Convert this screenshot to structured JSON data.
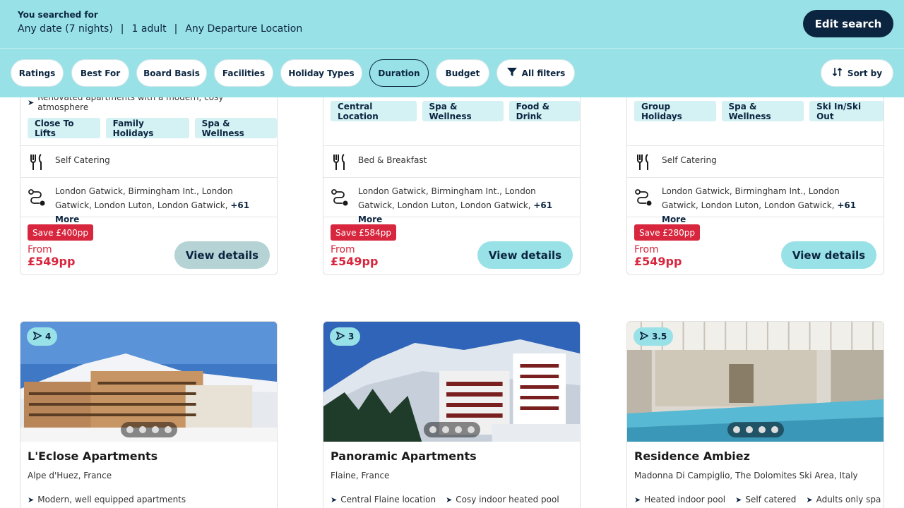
{
  "search": {
    "label": "You searched for",
    "date": "Any date (7 nights)",
    "guests": "1 adult",
    "departure": "Any Departure Location",
    "edit_label": "Edit search"
  },
  "filters": [
    "Ratings",
    "Best For",
    "Board Basis",
    "Facilities",
    "Holiday Types",
    "Duration",
    "Budget",
    "All filters"
  ],
  "sort_label": "Sort by",
  "top_cards": [
    {
      "highlight": "Renovated apartments with a modern, cosy atmosphere",
      "tags": [
        "Close To Lifts",
        "Family Holidays",
        "Spa & Wellness"
      ],
      "board": "Self Catering",
      "flights": "London Gatwick, Birmingham Int., London Gatwick, London Luton, London Gatwick,",
      "more": "+61 More",
      "save": "Save £400pp",
      "from": "From",
      "price": "£549pp",
      "button": "View details"
    },
    {
      "tags": [
        "Central Location",
        "Spa & Wellness",
        "Food & Drink"
      ],
      "board": "Bed & Breakfast",
      "flights": "London Gatwick, Birmingham Int., London Gatwick, London Luton, London Gatwick,",
      "more": "+61 More",
      "save": "Save £584pp",
      "from": "From",
      "price": "£549pp",
      "button": "View details"
    },
    {
      "tags": [
        "Group Holidays",
        "Spa & Wellness",
        "Ski In/Ski Out"
      ],
      "board": "Self Catering",
      "flights": "London Gatwick, Birmingham Int., London Gatwick, London Luton, London Gatwick,",
      "more": "+61 More",
      "save": "Save £280pp",
      "from": "From",
      "price": "£549pp",
      "button": "View details"
    }
  ],
  "bottom_cards": [
    {
      "rating": "4",
      "name": "L'Eclose Apartments",
      "location": "Alpe d'Huez, France",
      "features": [
        "Modern, well equipped apartments"
      ]
    },
    {
      "rating": "3",
      "name": "Panoramic Apartments",
      "location": "Flaine, France",
      "features": [
        "Central Flaine location",
        "Cosy indoor heated pool"
      ]
    },
    {
      "rating": "3.5",
      "name": "Residence Ambiez",
      "location": "Madonna Di Campiglio, The Dolomites Ski Area, Italy",
      "features": [
        "Heated indoor pool",
        "Self catered",
        "Adults only spa"
      ]
    }
  ],
  "colors": {
    "header_bg": "#98e1e7",
    "navy": "#0b2540",
    "sale_red": "#d7263d",
    "tag_bg": "#d4f1f4"
  }
}
